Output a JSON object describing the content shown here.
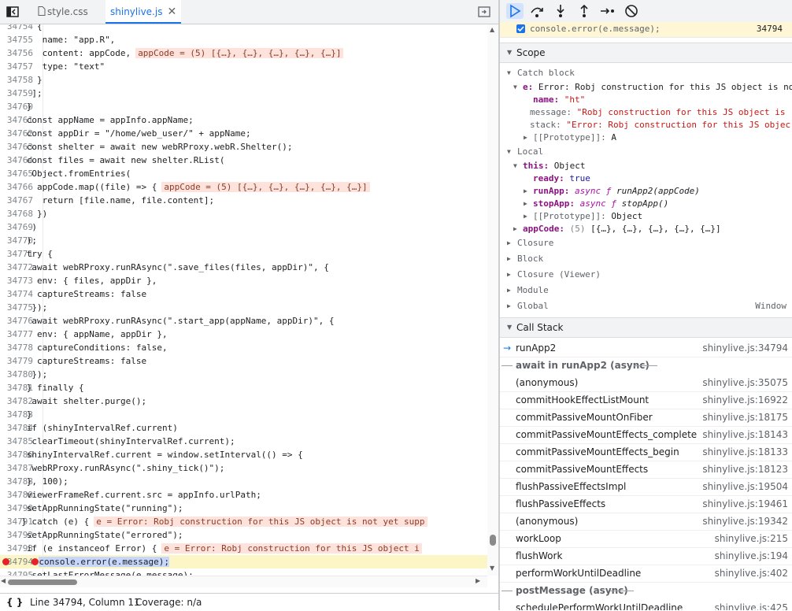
{
  "tabs": [
    {
      "label": "style.css",
      "active": false
    },
    {
      "label": "shinylive.js",
      "active": true
    }
  ],
  "code": {
    "lines": [
      {
        "n": "34754",
        "t": "{"
      },
      {
        "n": "34755",
        "t": "name: \"app.R\","
      },
      {
        "n": "34756",
        "t": "content: appCode,",
        "inline": "appCode = (5) [{…}, {…}, {…}, {…}, {…}]"
      },
      {
        "n": "34757",
        "t": "type: \"text\""
      },
      {
        "n": "34758",
        "t": "}"
      },
      {
        "n": "34759",
        "t": "];"
      },
      {
        "n": "34760",
        "t": "}"
      },
      {
        "n": "34761",
        "t": "const appName = appInfo.appName;"
      },
      {
        "n": "34762",
        "t": "const appDir = \"/home/web_user/\" + appName;"
      },
      {
        "n": "34763",
        "t": "const shelter = await new webRProxy.webR.Shelter();"
      },
      {
        "n": "34764",
        "t": "const files = await new shelter.RList("
      },
      {
        "n": "34765",
        "t": "Object.fromEntries("
      },
      {
        "n": "34766",
        "t": "appCode.map((file) => {",
        "inline": "appCode = (5) [{…}, {…}, {…}, {…}, {…}]"
      },
      {
        "n": "34767",
        "t": "return [file.name, file.content];"
      },
      {
        "n": "34768",
        "t": "})"
      },
      {
        "n": "34769",
        "t": ")"
      },
      {
        "n": "34770",
        "t": ");"
      },
      {
        "n": "34771",
        "t": "try {"
      },
      {
        "n": "34772",
        "t": "await webRProxy.runRAsync(\".save_files(files, appDir)\", {"
      },
      {
        "n": "34773",
        "t": "env: { files, appDir },"
      },
      {
        "n": "34774",
        "t": "captureStreams: false"
      },
      {
        "n": "34775",
        "t": "});"
      },
      {
        "n": "34776",
        "t": "await webRProxy.runRAsync(\".start_app(appName, appDir)\", {"
      },
      {
        "n": "34777",
        "t": "env: { appName, appDir },"
      },
      {
        "n": "34778",
        "t": "captureConditions: false,"
      },
      {
        "n": "34779",
        "t": "captureStreams: false"
      },
      {
        "n": "34780",
        "t": "});"
      },
      {
        "n": "34781",
        "t": "} finally {"
      },
      {
        "n": "34782",
        "t": "await shelter.purge();"
      },
      {
        "n": "34783",
        "t": "}"
      },
      {
        "n": "34784",
        "t": "if (shinyIntervalRef.current)"
      },
      {
        "n": "34785",
        "t": "clearTimeout(shinyIntervalRef.current);"
      },
      {
        "n": "34786",
        "t": "shinyIntervalRef.current = window.setInterval(() => {"
      },
      {
        "n": "34787",
        "t": "webRProxy.runRAsync(\".shiny_tick()\");"
      },
      {
        "n": "34788",
        "t": "}, 100);"
      },
      {
        "n": "34789",
        "t": "viewerFrameRef.current.src = appInfo.urlPath;"
      },
      {
        "n": "34790",
        "t": "setAppRunningState(\"running\");"
      },
      {
        "n": "34791",
        "t": "} catch (e) {",
        "inline": "e = Error: Robj construction for this JS object is not yet supp"
      },
      {
        "n": "34792",
        "t": "setAppRunningState(\"errored\");"
      },
      {
        "n": "34793",
        "t": "if (e instanceof Error) {",
        "inline": "e = Error: Robj construction for this JS object i"
      },
      {
        "n": "34794",
        "t": "console.error(e.message);"
      },
      {
        "n": "34795",
        "t": "setLastErrorMessage(e.message);"
      }
    ]
  },
  "status": {
    "braces": "{ }",
    "position": "Line 34794, Column 11",
    "coverage": "Coverage: n/a"
  },
  "breakpoint": {
    "code": "console.error(e.message);",
    "line": "34794"
  },
  "scope": {
    "title": "Scope",
    "catch_block": "Catch block",
    "e_key": "e:",
    "e_value": "Error: Robj construction for this JS object is no",
    "name_key": "name:",
    "name_value": "\"ht\"",
    "message_key": "message:",
    "message_value": "\"Robj construction for this JS object is",
    "stack_key": "stack:",
    "stack_value": "\"Error: Robj construction for this JS objec",
    "proto_key": "[[Prototype]]:",
    "proto_value": "A",
    "local": "Local",
    "this_key": "this:",
    "this_value": "Object",
    "ready_key": "ready:",
    "ready_value": "true",
    "runapp_key": "runApp:",
    "runapp_kw": "async ƒ",
    "runapp_value": "runApp2(appCode)",
    "stopapp_key": "stopApp:",
    "stopapp_kw": "async ƒ",
    "stopapp_value": "stopApp()",
    "proto2_key": "[[Prototype]]:",
    "proto2_value": "Object",
    "appcode_key": "appCode:",
    "appcode_count": "(5)",
    "appcode_value": "[{…}, {…}, {…}, {…}, {…}]",
    "closure": "Closure",
    "block": "Block",
    "closure_viewer": "Closure (Viewer)",
    "module": "Module",
    "global": "Global",
    "global_value": "Window"
  },
  "callstack": {
    "title": "Call Stack",
    "frames": [
      {
        "fn": "runApp2",
        "loc": "shinylive.js:34794",
        "current": true
      },
      {
        "async": "await in runApp2 (async)"
      },
      {
        "fn": "(anonymous)",
        "loc": "shinylive.js:35075"
      },
      {
        "fn": "commitHookEffectListMount",
        "loc": "shinylive.js:16922"
      },
      {
        "fn": "commitPassiveMountOnFiber",
        "loc": "shinylive.js:18175"
      },
      {
        "fn": "commitPassiveMountEffects_complete",
        "loc": "shinylive.js:18143"
      },
      {
        "fn": "commitPassiveMountEffects_begin",
        "loc": "shinylive.js:18133"
      },
      {
        "fn": "commitPassiveMountEffects",
        "loc": "shinylive.js:18123"
      },
      {
        "fn": "flushPassiveEffectsImpl",
        "loc": "shinylive.js:19504"
      },
      {
        "fn": "flushPassiveEffects",
        "loc": "shinylive.js:19461"
      },
      {
        "fn": "(anonymous)",
        "loc": "shinylive.js:19342"
      },
      {
        "fn": "workLoop",
        "loc": "shinylive.js:215"
      },
      {
        "fn": "flushWork",
        "loc": "shinylive.js:194"
      },
      {
        "fn": "performWorkUntilDeadline",
        "loc": "shinylive.js:402"
      },
      {
        "async": "postMessage (async)"
      },
      {
        "fn": "schedulePerformWorkUntilDeadline",
        "loc": "shinylive.js:425"
      }
    ]
  },
  "colors": {
    "accent": "#1a73e8",
    "breakpoint": "#e52228",
    "paused_line": "#fcf5c6",
    "inline_value_bg": "#fde3db"
  }
}
